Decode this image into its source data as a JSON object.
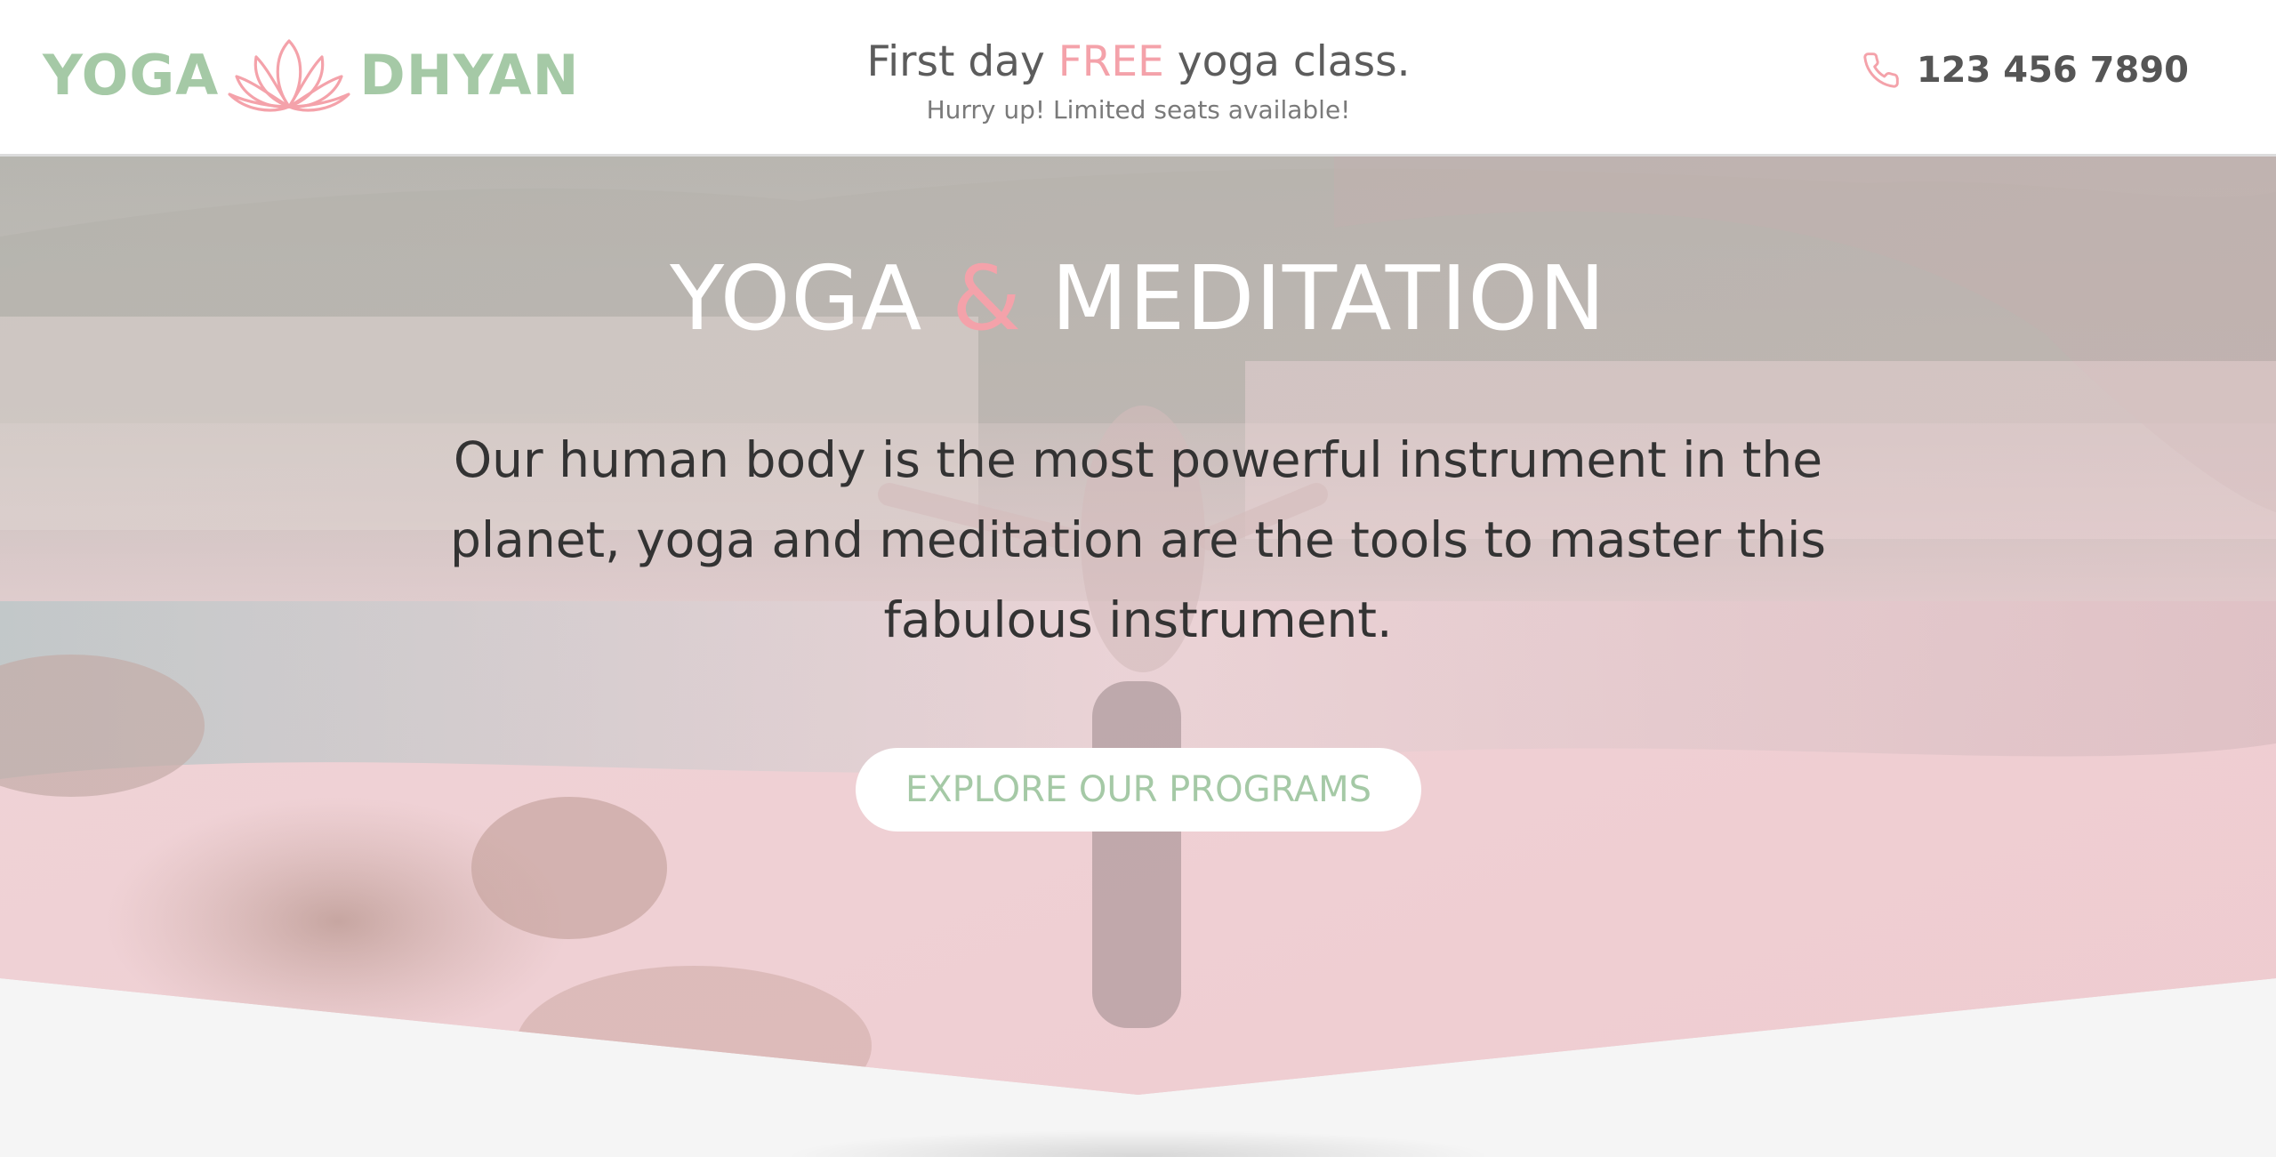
{
  "brand": {
    "name_left": "YOGA",
    "name_right": "DHYAN",
    "icon": "lotus-icon",
    "color": "#a5c9a6",
    "icon_color": "#f4a2aa"
  },
  "promo": {
    "title_before": "First day ",
    "title_highlight": "FREE",
    "title_after": " yoga class.",
    "subtitle": "Hurry up! Limited seats available!"
  },
  "contact": {
    "phone_icon": "phone-icon",
    "phone": "123 456 7890"
  },
  "hero": {
    "title_left": "YOGA ",
    "title_amp": "&",
    "title_right": " MEDITATION",
    "text": "Our human body is the most powerful instrument in the planet, yoga and meditation are the tools to master this fabulous instrument.",
    "cta_label": "EXPLORE OUR PROGRAMS"
  },
  "colors": {
    "accent_green": "#a5c9a6",
    "accent_pink": "#f4a2aa",
    "text_dark": "#333333",
    "background": "#f5f5f5"
  }
}
